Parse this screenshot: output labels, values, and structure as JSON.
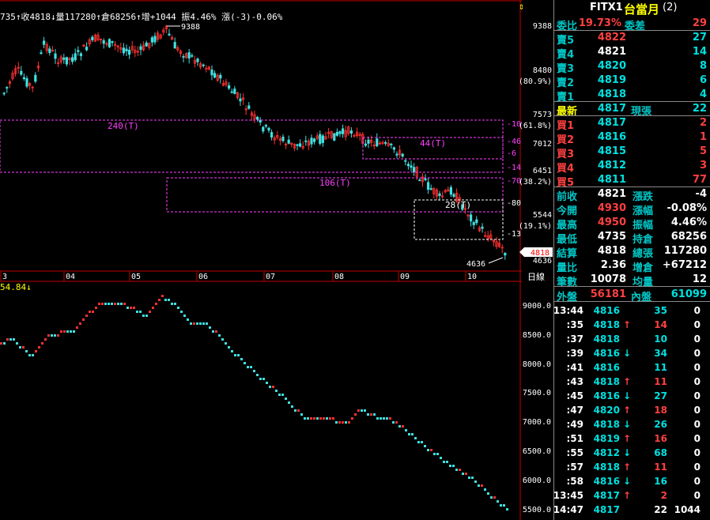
{
  "info_bar": {
    "text": "735↑收4818↓量117280↑倉68256↑增+1044 振4.46% 漲(-3)-0.06%"
  },
  "oscillator_label": "54.84↓",
  "price_axis": {
    "labels": [
      "9388",
      "8480",
      "(80.9%)",
      "7573",
      "(61.8%)",
      "7012",
      "6451",
      "(38.2%)",
      "5544",
      "(19.1%)",
      "4818",
      "4636"
    ],
    "current": "4818"
  },
  "time_axis": {
    "labels": [
      "3",
      "04",
      "05",
      "06",
      "07",
      "08",
      "09",
      "10"
    ],
    "weekly_label": "日線"
  },
  "annotations": {
    "high": "9388",
    "low": "4636",
    "box1": "240(T)",
    "box2": "106(T)",
    "box3": "44(T)",
    "box4": "28(T)",
    "right_marks": [
      "-10",
      "-46",
      "-6",
      "-14",
      "-70",
      "-80",
      "-13"
    ]
  },
  "osc_axis": {
    "labels": [
      "9000.0",
      "8500.0",
      "8000.0",
      "7500.0",
      "7000.0",
      "6500.0",
      "6000.0",
      "5500.0"
    ]
  },
  "panel": {
    "symbol": "FITX1",
    "name": "台當月",
    "sub": "(2)",
    "ratio_label": "委比",
    "ratio_value": "19.73%",
    "diff_label": "委差",
    "diff_value": "29",
    "asks": [
      {
        "label": "賣5",
        "price": "4822",
        "qty": "27"
      },
      {
        "label": "賣4",
        "price": "4821",
        "qty": "14"
      },
      {
        "label": "賣3",
        "price": "4820",
        "qty": "8"
      },
      {
        "label": "賣2",
        "price": "4819",
        "qty": "6"
      },
      {
        "label": "賣1",
        "price": "4818",
        "qty": "4"
      }
    ],
    "last": {
      "label": "最新",
      "price": "4817",
      "qty_label": "現張",
      "qty": "22"
    },
    "bids": [
      {
        "label": "買1",
        "price": "4817",
        "qty": "2"
      },
      {
        "label": "買2",
        "price": "4816",
        "qty": "1"
      },
      {
        "label": "買3",
        "price": "4815",
        "qty": "5"
      },
      {
        "label": "買4",
        "price": "4812",
        "qty": "3"
      },
      {
        "label": "買5",
        "price": "4811",
        "qty": "77"
      }
    ],
    "stats": [
      {
        "l1": "前收",
        "v1": "4821",
        "l2": "漲跌",
        "v2": "-4",
        "c1": "#fff",
        "c2": "#fff"
      },
      {
        "l1": "今開",
        "v1": "4930",
        "l2": "漲幅",
        "v2": "-0.08%",
        "c1": "#ff4040",
        "c2": "#fff"
      },
      {
        "l1": "最高",
        "v1": "4950",
        "l2": "振幅",
        "v2": "4.46%",
        "c1": "#ff4040",
        "c2": "#fff"
      },
      {
        "l1": "最低",
        "v1": "4735",
        "l2": "持倉",
        "v2": "68256",
        "c1": "#fff",
        "c2": "#fff"
      },
      {
        "l1": "結算",
        "v1": "4818",
        "l2": "總張",
        "v2": "117280",
        "c1": "#fff",
        "c2": "#fff"
      },
      {
        "l1": "量比",
        "v1": "2.36",
        "l2": "增倉",
        "v2": "+67212",
        "c1": "#fff",
        "c2": "#fff"
      },
      {
        "l1": "筆數",
        "v1": "10078",
        "l2": "均量",
        "v2": "12",
        "c1": "#fff",
        "c2": "#fff"
      }
    ],
    "outer_label": "外盤",
    "outer_value": "56181",
    "inner_label": "內盤",
    "inner_value": "61099",
    "ticks": [
      {
        "t": "13:44",
        "p": "4816",
        "d": "",
        "q": "35",
        "z": "0",
        "c": "cyan"
      },
      {
        "t": ":35",
        "p": "4818",
        "d": "↑",
        "q": "14",
        "z": "0",
        "c": "red"
      },
      {
        "t": ":37",
        "p": "4818",
        "d": "",
        "q": "10",
        "z": "0",
        "c": "cyan"
      },
      {
        "t": ":39",
        "p": "4816",
        "d": "↓",
        "q": "34",
        "z": "0",
        "c": "cyan"
      },
      {
        "t": ":41",
        "p": "4816",
        "d": "",
        "q": "11",
        "z": "0",
        "c": "cyan"
      },
      {
        "t": ":43",
        "p": "4818",
        "d": "↑",
        "q": "11",
        "z": "0",
        "c": "red"
      },
      {
        "t": ":45",
        "p": "4816",
        "d": "↓",
        "q": "27",
        "z": "0",
        "c": "cyan"
      },
      {
        "t": ":47",
        "p": "4820",
        "d": "↑",
        "q": "18",
        "z": "0",
        "c": "red"
      },
      {
        "t": ":49",
        "p": "4818",
        "d": "↓",
        "q": "26",
        "z": "0",
        "c": "cyan"
      },
      {
        "t": ":51",
        "p": "4819",
        "d": "↑",
        "q": "16",
        "z": "0",
        "c": "red"
      },
      {
        "t": ":55",
        "p": "4812",
        "d": "↓",
        "q": "68",
        "z": "0",
        "c": "cyan"
      },
      {
        "t": ":57",
        "p": "4818",
        "d": "↑",
        "q": "11",
        "z": "0",
        "c": "red"
      },
      {
        "t": ":58",
        "p": "4816",
        "d": "↓",
        "q": "16",
        "z": "0",
        "c": "cyan"
      },
      {
        "t": "13:45",
        "p": "4817",
        "d": "↑",
        "q": "2",
        "z": "0",
        "c": "red"
      },
      {
        "t": "14:47",
        "p": "4817",
        "d": "",
        "q": "22",
        "z": "1044",
        "c": "white"
      }
    ]
  },
  "colors": {
    "up": "#ff3030",
    "down": "#40e0e0",
    "accent": "#ffff00",
    "box": "#ff40ff"
  }
}
